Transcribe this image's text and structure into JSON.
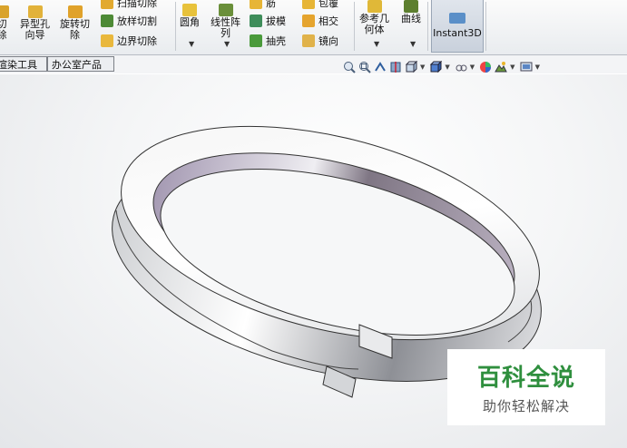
{
  "ribbon": {
    "buttons": [
      {
        "id": "cut_partial",
        "label": "切\n除",
        "color": "#d9a32b"
      },
      {
        "id": "hole_wizard",
        "label": "异型孔\n向导",
        "color": "#e2b23a"
      },
      {
        "id": "revolved_cut",
        "label": "旋转切\n除",
        "color": "#e0a22a"
      },
      {
        "id": "fillet",
        "label": "圆角",
        "color": "#e8c23b"
      },
      {
        "id": "linear_pattern",
        "label": "线性阵\n列",
        "color": "#6a8f3a"
      },
      {
        "id": "ref_geometry",
        "label": "参考几\n何体",
        "color": "#e0b838"
      },
      {
        "id": "curves",
        "label": "曲线",
        "color": "#5d7f2f"
      }
    ],
    "small_rows": [
      {
        "id": "swept_cut",
        "label": "扫描切除",
        "color": "#e2a92f"
      },
      {
        "id": "lofted_cut",
        "label": "放样切割",
        "color": "#4d8a36"
      },
      {
        "id": "boundary_cut",
        "label": "边界切除",
        "color": "#e9b83d"
      },
      {
        "id": "rib",
        "label": "筋",
        "color": "#e7b536"
      },
      {
        "id": "draft",
        "label": "拔模",
        "color": "#3e8d5a"
      },
      {
        "id": "shell",
        "label": "抽壳",
        "color": "#4a9a3b"
      },
      {
        "id": "wrap",
        "label": "包覆",
        "color": "#e7b536"
      },
      {
        "id": "intersect",
        "label": "相交",
        "color": "#e5a42e"
      },
      {
        "id": "mirror",
        "label": "镜向",
        "color": "#e0b24a"
      }
    ],
    "instant3d": "Instant3D"
  },
  "tabs": [
    "渲染工具",
    "办公室产品"
  ],
  "hud_icons": [
    "zoom-to-fit-icon",
    "zoom-area-icon",
    "previous-view-icon",
    "section-view-icon",
    "view-orientation-icon",
    "display-style-icon",
    "hide-show-icon",
    "edit-appearance-icon",
    "apply-scene-icon",
    "view-settings-icon"
  ],
  "watermark": {
    "title": "百科全说",
    "subtitle": "助你轻松解决"
  },
  "colors": {
    "accent": "#2f8f3e",
    "ring_inner": "#9a8fa6",
    "ring_outer": "#cfd2d6"
  }
}
